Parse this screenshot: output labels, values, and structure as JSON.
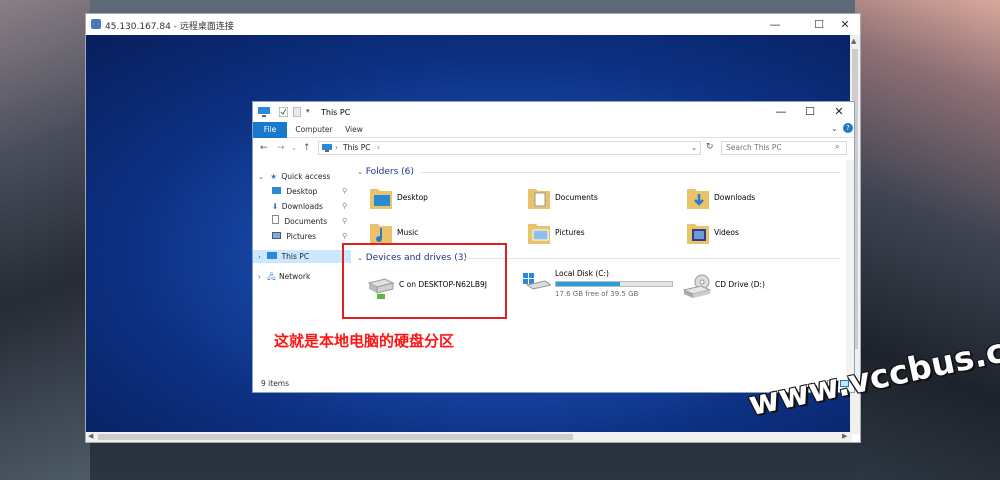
{
  "remote": {
    "title": "45.130.167.84 - 远程桌面连接",
    "minimize": "—",
    "maximize": "☐",
    "close": "✕"
  },
  "explorer": {
    "title": "This PC",
    "minimize": "—",
    "maximize": "☐",
    "close": "✕",
    "tabs": [
      "File",
      "Computer",
      "View"
    ],
    "address": "This PC",
    "search_placeholder": "Search This PC",
    "nav": [
      {
        "label": "Quick access"
      },
      {
        "label": "Desktop"
      },
      {
        "label": "Downloads"
      },
      {
        "label": "Documents"
      },
      {
        "label": "Pictures"
      },
      {
        "label": "This PC"
      },
      {
        "label": "Network"
      }
    ],
    "folders_header": "Folders (6)",
    "folders": [
      "Desktop",
      "Documents",
      "Downloads",
      "Music",
      "Pictures",
      "Videos"
    ],
    "devices_header": "Devices and drives (3)",
    "drives": [
      {
        "name": "C on DESKTOP-N62LB9J"
      },
      {
        "name": "Local Disk (C:)",
        "free": "17.6 GB free of 39.5 GB",
        "used_fraction": 0.55
      },
      {
        "name": "CD Drive (D:)"
      }
    ],
    "status": "9 items"
  },
  "annotation": "这就是本地电脑的硬盘分区",
  "watermark": "www.vccbus.com",
  "colors": {
    "accent": "#1979ca",
    "highlight": "#e02020",
    "annotation": "#ff1414",
    "group_header": "#1e3287"
  }
}
